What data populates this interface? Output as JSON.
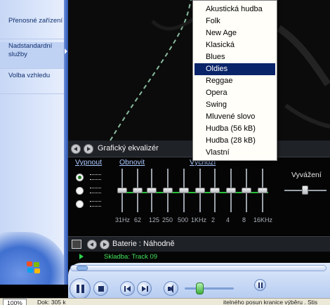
{
  "sidebar": {
    "items": [
      {
        "label": "Přenosné zařízení"
      },
      {
        "label": "Nadstandardní služby"
      },
      {
        "label": "Volba vzhledu"
      }
    ]
  },
  "equalizer": {
    "title": "Grafický ekvalizér",
    "links": {
      "off": "Vypnout",
      "reset": "Obnovit",
      "preset": "Výchozí"
    },
    "bands": [
      {
        "label": "31Hz",
        "level": 0.5
      },
      {
        "label": "62",
        "level": 0.5
      },
      {
        "label": "125",
        "level": 0.5
      },
      {
        "label": "250",
        "level": 0.5
      },
      {
        "label": "500",
        "level": 0.5
      },
      {
        "label": "1KHz",
        "level": 0.5
      },
      {
        "label": "2",
        "level": 0.5
      },
      {
        "label": "4",
        "level": 0.5
      },
      {
        "label": "8",
        "level": 0.5
      },
      {
        "label": "16KHz",
        "level": 0.5
      }
    ],
    "balance_label": "Vyvážení",
    "balance_value": 0.5
  },
  "preset_menu": {
    "items": [
      "Akustická hudba",
      "Folk",
      "New Age",
      "Klasická",
      "Blues",
      "Oldies",
      "Reggae",
      "Opera",
      "Swing",
      "Mluvené slovo",
      "Hudba (56 kB)",
      "Hudba (28 kB)",
      "Vlastní"
    ],
    "selected": "Oldies"
  },
  "playlist": {
    "title": "Baterie : Náhodně",
    "now_playing": "Skladba: Track 09"
  },
  "volume_level": 0.3,
  "status": {
    "zoom": "100%",
    "text1": "Dok: 305 k",
    "text2": "itelného posun kranice výběru . Stis"
  },
  "colors": {
    "accent_green": "#27c23a",
    "selection": "#0a246a",
    "link": "#a9c7ff"
  }
}
